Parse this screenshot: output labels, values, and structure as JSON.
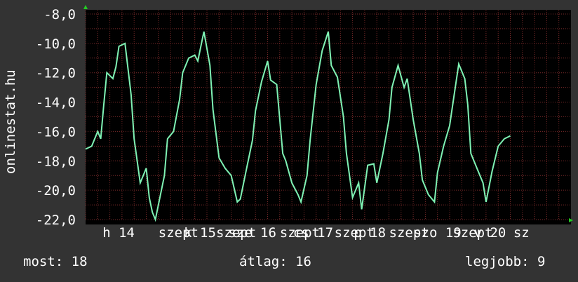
{
  "watermark": "onlinestat.hu",
  "stats": {
    "current_label": "most:",
    "current_value": "18",
    "average_label": "átlag:",
    "average_value": "16",
    "best_label": "legjobb:",
    "best_value": "9"
  },
  "colors": {
    "background": "#333333",
    "plot_background": "#000000",
    "line": "#7FF2B4",
    "grid": "#7a2a2a",
    "axis_text": "#ffffff",
    "arrow": "#22cc22"
  },
  "chart_data": {
    "type": "line",
    "ylim": [
      -22,
      -8
    ],
    "yticks": [
      -8,
      -10,
      -12,
      -14,
      -16,
      -18,
      -20,
      -22
    ],
    "ytick_labels": [
      "-8,0",
      "-10,0",
      "-12,0",
      "-14,0",
      "-16,0",
      "-18,0",
      "-20,0",
      "-22,0"
    ],
    "xlim": [
      0,
      8.0
    ],
    "xticks": [
      {
        "pos": 0.28,
        "label": "h 14"
      },
      {
        "pos": 1.2,
        "label": "szept"
      },
      {
        "pos": 1.62,
        "label": "k 15"
      },
      {
        "pos": 2.15,
        "label": "szept"
      },
      {
        "pos": 2.35,
        "label": "sze 16"
      },
      {
        "pos": 3.2,
        "label": "szept"
      },
      {
        "pos": 3.42,
        "label": "cs 17"
      },
      {
        "pos": 4.1,
        "label": "szept"
      },
      {
        "pos": 4.42,
        "label": "p 18"
      },
      {
        "pos": 5.0,
        "label": "szept"
      },
      {
        "pos": 5.4,
        "label": "szo 19"
      },
      {
        "pos": 6.05,
        "label": "szept"
      },
      {
        "pos": 6.4,
        "label": "v 20"
      },
      {
        "pos": 7.05,
        "label": "sz"
      }
    ],
    "series": [
      {
        "x": [
          0.0,
          0.1,
          0.2,
          0.25,
          0.3,
          0.35,
          0.45,
          0.5,
          0.55,
          0.65,
          0.75,
          0.8,
          0.9,
          1.0,
          1.05,
          1.1,
          1.15,
          1.2,
          1.3,
          1.35,
          1.45,
          1.55,
          1.6,
          1.7,
          1.8,
          1.85,
          1.95,
          2.05,
          2.1,
          2.2,
          2.3,
          2.4,
          2.5,
          2.55,
          2.65,
          2.75,
          2.8,
          2.9,
          3.0,
          3.05,
          3.15,
          3.25,
          3.3,
          3.4,
          3.5,
          3.55,
          3.65,
          3.7,
          3.8,
          3.9,
          4.0,
          4.05,
          4.15,
          4.25,
          4.3,
          4.4,
          4.5,
          4.55,
          4.65,
          4.75,
          4.8,
          4.9,
          5.0,
          5.05,
          5.15,
          5.25,
          5.3,
          5.4,
          5.5,
          5.55,
          5.65,
          5.75,
          5.8,
          5.9,
          6.0,
          6.05,
          6.15,
          6.25,
          6.3,
          6.35,
          6.45,
          6.55,
          6.6,
          6.7,
          6.8,
          6.9,
          7.0
        ],
        "y": [
          -17.2,
          -17.0,
          -16.0,
          -16.5,
          -14.2,
          -12.0,
          -12.4,
          -11.6,
          -10.2,
          -10.0,
          -13.5,
          -16.5,
          -19.5,
          -18.5,
          -20.5,
          -21.5,
          -22.0,
          -21.0,
          -19.0,
          -16.5,
          -16.0,
          -13.8,
          -12.0,
          -11.0,
          -10.8,
          -11.2,
          -9.2,
          -11.5,
          -14.5,
          -17.8,
          -18.5,
          -19.0,
          -20.8,
          -20.6,
          -18.6,
          -16.6,
          -14.6,
          -12.6,
          -11.2,
          -12.5,
          -12.8,
          -17.5,
          -18.0,
          -19.5,
          -20.3,
          -20.8,
          -19.0,
          -16.6,
          -12.8,
          -10.5,
          -9.2,
          -11.5,
          -12.3,
          -15.0,
          -17.5,
          -20.5,
          -19.5,
          -21.3,
          -18.3,
          -18.2,
          -19.5,
          -17.5,
          -15.2,
          -13.0,
          -11.5,
          -13.0,
          -12.4,
          -15.2,
          -17.5,
          -19.3,
          -20.3,
          -20.8,
          -18.8,
          -17.0,
          -15.6,
          -14.2,
          -11.4,
          -12.4,
          -14.2,
          -17.5,
          -18.5,
          -19.5,
          -20.8,
          -18.7,
          -17.0,
          -16.5,
          -16.3
        ]
      }
    ]
  }
}
